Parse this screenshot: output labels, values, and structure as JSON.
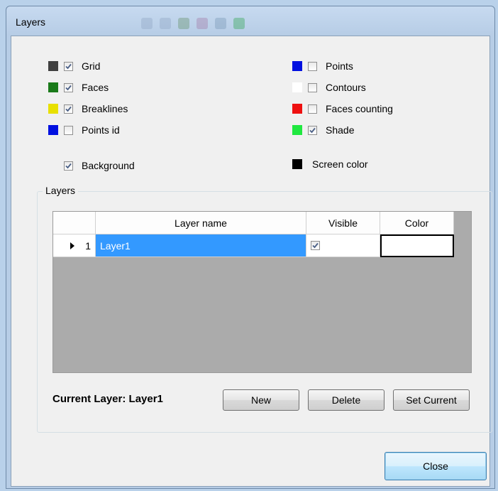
{
  "window": {
    "title": "Layers"
  },
  "options": {
    "grid": {
      "label": "Grid",
      "checked": true,
      "color": "#404040"
    },
    "faces": {
      "label": "Faces",
      "checked": true,
      "color": "#1a7a1a"
    },
    "breaklines": {
      "label": "Breaklines",
      "checked": true,
      "color": "#e8e000"
    },
    "points_id": {
      "label": "Points id",
      "checked": false,
      "color": "#0010e0"
    },
    "points": {
      "label": "Points",
      "checked": false,
      "color": "#0010e0"
    },
    "contours": {
      "label": "Contours",
      "checked": false,
      "color": "#ffffff"
    },
    "faces_counting": {
      "label": "Faces counting",
      "checked": false,
      "color": "#ee1010"
    },
    "shade": {
      "label": "Shade",
      "checked": true,
      "color": "#20e840"
    },
    "background": {
      "label": "Background",
      "checked": true
    },
    "screen_color": {
      "label": "Screen color",
      "color": "#000000"
    }
  },
  "layers_group": {
    "title": "Layers",
    "columns": [
      "Layer name",
      "Visible",
      "Color"
    ],
    "rows": [
      {
        "index": "1",
        "name": "Layer1",
        "visible": true
      }
    ]
  },
  "current_layer_text": "Current Layer: Layer1",
  "buttons": {
    "new": "New",
    "delete": "Delete",
    "set_current": "Set Current",
    "close": "Close"
  }
}
